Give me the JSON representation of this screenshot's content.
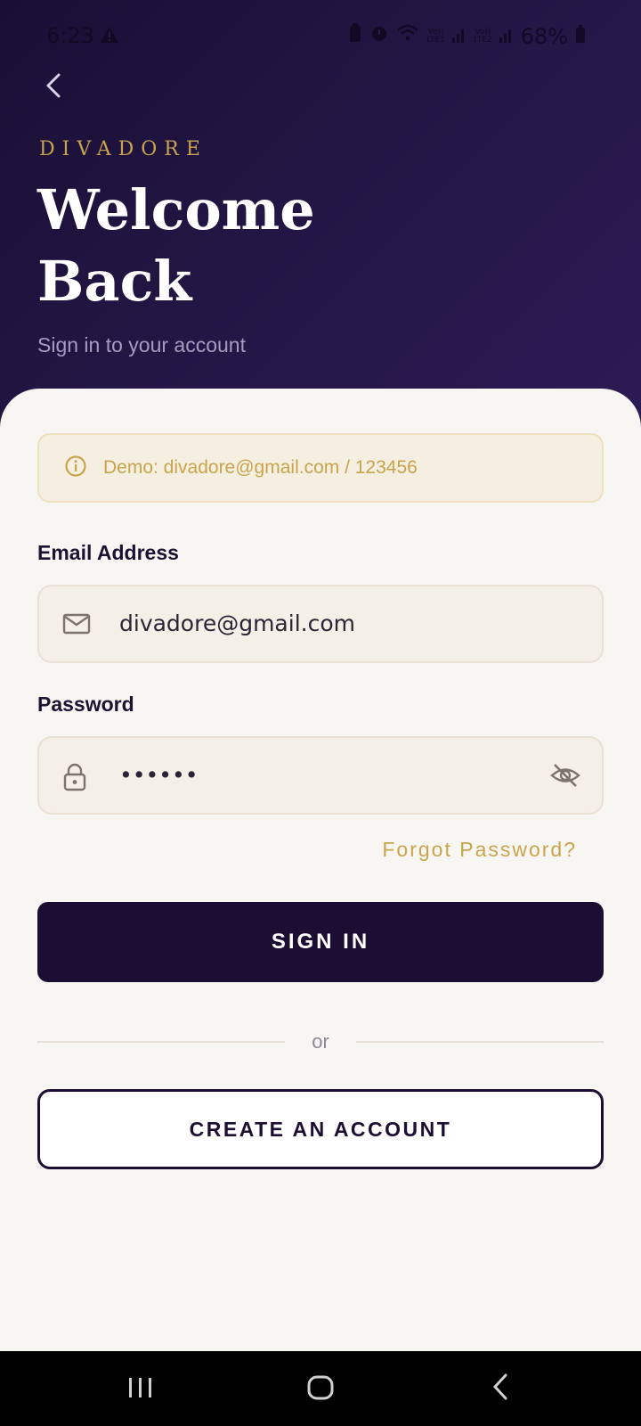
{
  "status_bar": {
    "time": "6:23",
    "battery_text": "68%",
    "sim1_label": "Vo))",
    "sim1_sub": "LTE1",
    "sim2_label": "Vo))",
    "sim2_sub": "LTE2"
  },
  "header": {
    "brand": "DIVADORE",
    "title": "Welcome Back",
    "subtitle": "Sign in to your account"
  },
  "demo_notice": {
    "text": "Demo: divadore@gmail.com / 123456",
    "icon": "info-icon"
  },
  "email": {
    "label": "Email Address",
    "value": "divadore@gmail.com",
    "icon": "mail-icon"
  },
  "password": {
    "label": "Password",
    "value": "••••••",
    "icon": "lock-icon",
    "toggle_icon": "eye-off-icon"
  },
  "forgot_password": "Forgot Password?",
  "sign_in_button": "SIGN IN",
  "divider_text": "or",
  "create_account_button": "CREATE AN ACCOUNT",
  "colors": {
    "header_bg": "#1c1238",
    "accent_gold": "#c9a44c",
    "primary_dark": "#1c0e33",
    "sheet_bg": "#f8f6f2"
  }
}
